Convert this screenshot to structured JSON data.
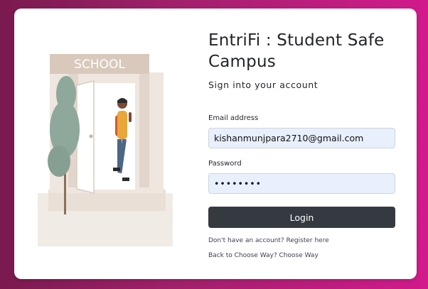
{
  "app": {
    "title": "EntriFi : Student Safe Campus",
    "subtitle": "Sign into your account"
  },
  "illustration": {
    "sign_text": "SCHOOL"
  },
  "form": {
    "email_label": "Email address",
    "email_value": "kishanmunjpara2710@gmail.com",
    "password_label": "Password",
    "password_value": "12345678",
    "login_label": "Login"
  },
  "links": {
    "register_prefix": "Don't have an account?",
    "register_link": "Register here",
    "back_prefix": "Back to Choose Way?",
    "back_link": "Choose Way"
  },
  "colors": {
    "background_start": "#7a1a4f",
    "background_end": "#d21a8c",
    "button": "#343a40",
    "input_fill": "#e8f0fe"
  }
}
